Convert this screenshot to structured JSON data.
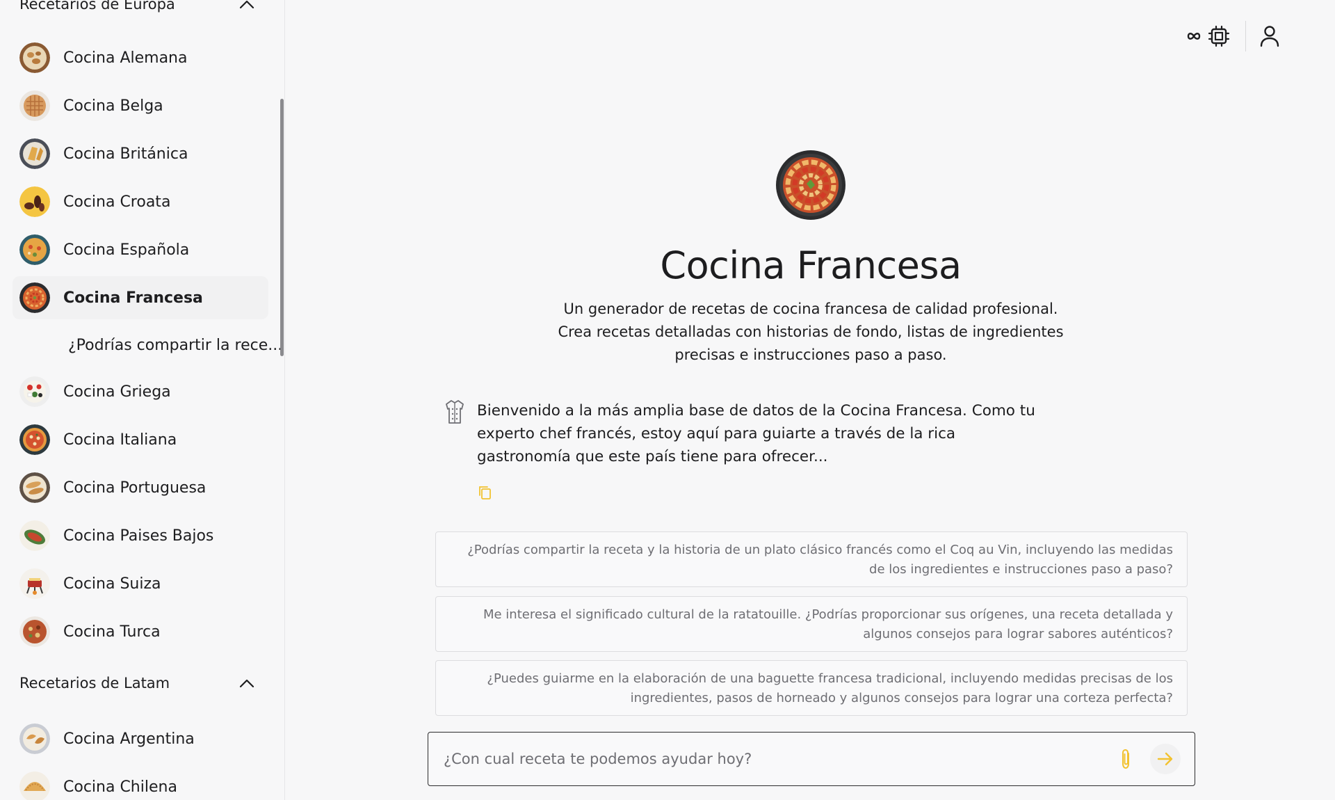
{
  "sidebar": {
    "europe_header": "Recetarios de Europa",
    "latam_header": "Recetarios de Latam",
    "europe_items": [
      {
        "label": "Cocina Alemana",
        "icon": "german-dish-icon"
      },
      {
        "label": "Cocina Belga",
        "icon": "belgian-waffle-icon"
      },
      {
        "label": "Cocina Británica",
        "icon": "british-dish-icon"
      },
      {
        "label": "Cocina Croata",
        "icon": "croatian-dish-icon"
      },
      {
        "label": "Cocina Española",
        "icon": "paella-icon"
      },
      {
        "label": "Cocina Francesa",
        "icon": "ratatouille-icon",
        "active": true
      },
      {
        "label": "¿Podrías compartir la rece...",
        "sub": true
      },
      {
        "label": "Cocina Griega",
        "icon": "greek-salad-icon"
      },
      {
        "label": "Cocina Italiana",
        "icon": "pizza-icon"
      },
      {
        "label": "Cocina Portuguesa",
        "icon": "portuguese-dish-icon"
      },
      {
        "label": "Cocina Paises Bajos",
        "icon": "dutch-dish-icon"
      },
      {
        "label": "Cocina Suiza",
        "icon": "fondue-icon"
      },
      {
        "label": "Cocina Turca",
        "icon": "turkish-dish-icon"
      }
    ],
    "latam_items": [
      {
        "label": "Cocina Argentina",
        "icon": "argentine-dish-icon"
      },
      {
        "label": "Cocina Chilena",
        "icon": "empanada-icon"
      }
    ]
  },
  "header": {
    "icons": [
      "infinity-icon",
      "cpu-chip-icon",
      "user-icon"
    ]
  },
  "main": {
    "title": "Cocina Francesa",
    "description": "Un generador de recetas de cocina francesa de calidad profesional. Crea recetas detalladas con historias de fondo, listas de ingredientes precisas e instrucciones paso a paso.",
    "welcome_message": "Bienvenido a la más amplia base de datos de la Cocina Francesa. Como tu experto chef francés, estoy aquí para guiarte a través de la rica gastronomía que este país tiene para ofrecer...",
    "suggestions": [
      "¿Podrías compartir la receta y la historia de un plato clásico francés como el Coq au Vin, incluyendo las medidas de los ingredientes e instrucciones paso a paso?",
      "Me interesa el significado cultural de la ratatouille. ¿Podrías proporcionar sus orígenes, una receta detallada y algunos consejos para lograr sabores auténticos?",
      "¿Puedes guiarme en la elaboración de una baguette francesa tradicional, incluyendo medidas precisas de los ingredientes, pasos de horneado y algunos consejos para lograr una corteza perfecta?"
    ],
    "composer_placeholder": "¿Con cual receta te podemos ayudar hoy?"
  },
  "colors": {
    "accent": "#f2c230",
    "text": "#1d1d1f",
    "muted": "#6e6e73",
    "background": "#f7f7f8"
  }
}
